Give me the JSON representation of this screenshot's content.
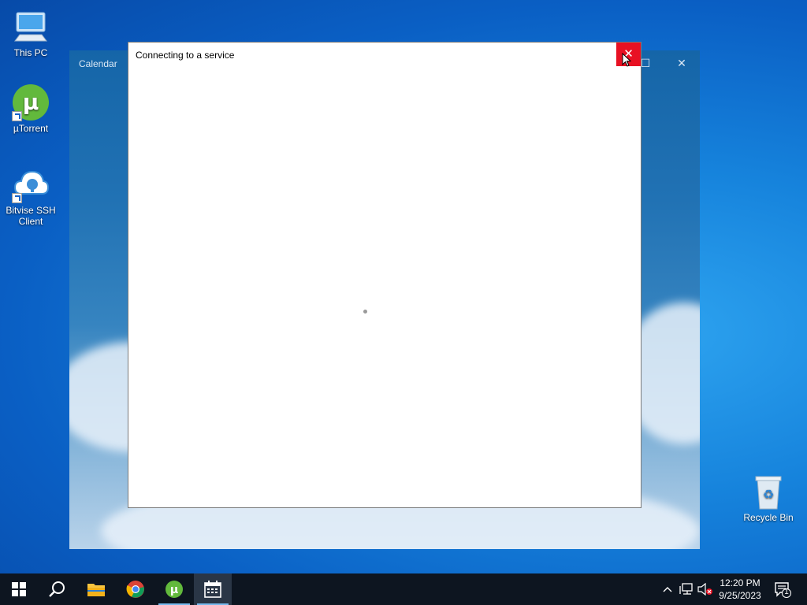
{
  "desktop": {
    "icons": [
      {
        "label": "This PC",
        "icon": "computer-icon"
      },
      {
        "label": "µTorrent",
        "icon": "utorrent-icon"
      },
      {
        "label": "Bitvise SSH Client",
        "icon": "bitvise-icon"
      },
      {
        "label": "Recycle Bin",
        "icon": "recycle-bin-icon"
      }
    ]
  },
  "calendar_window": {
    "title": "Calendar",
    "minimize_glyph": "—",
    "maximize_glyph": "☐",
    "close_glyph": "✕"
  },
  "dialog": {
    "title": "Connecting to a service",
    "close_glyph": "✕",
    "state": "loading"
  },
  "taskbar": {
    "pinned": [
      {
        "name": "start",
        "icon": "windows-logo-icon"
      },
      {
        "name": "search",
        "icon": "search-icon"
      },
      {
        "name": "file-explorer",
        "icon": "folder-icon"
      },
      {
        "name": "chrome",
        "icon": "chrome-icon"
      },
      {
        "name": "utorrent",
        "icon": "utorrent-icon"
      },
      {
        "name": "calendar",
        "icon": "calendar-icon",
        "active": true
      }
    ],
    "tray": {
      "chevron": "^",
      "network_icon": "network-icon",
      "volume_icon": "volume-muted-icon",
      "time": "12:20 PM",
      "date": "9/25/2023",
      "notification_count": "1"
    }
  },
  "colors": {
    "close_red": "#e81123",
    "taskbar": "#0d1520",
    "accent": "#76b9ed"
  }
}
